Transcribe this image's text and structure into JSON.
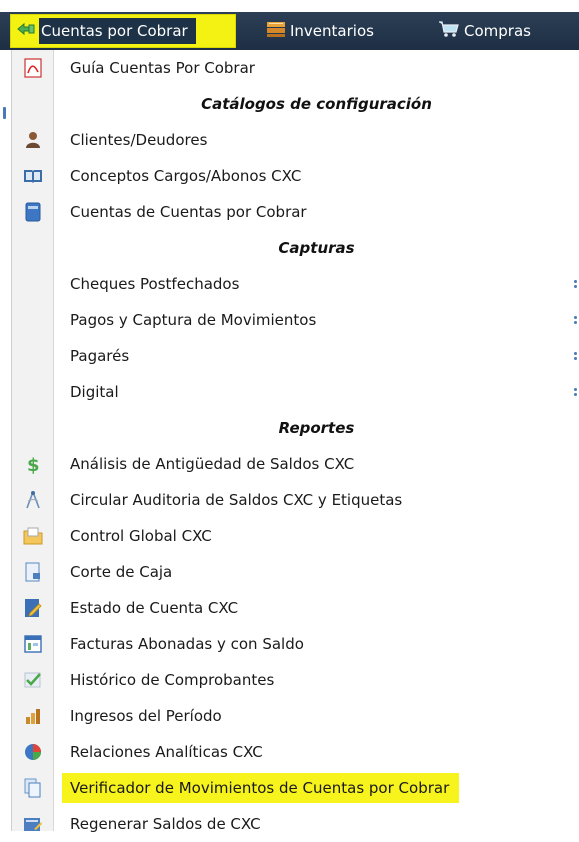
{
  "menubar": {
    "items": [
      {
        "label": "Cuentas por Cobrar",
        "icon": "cuentas-arrow-icon"
      },
      {
        "label": "Inventarios",
        "icon": "inventory-icon"
      },
      {
        "label": "Compras",
        "icon": "cart-icon"
      }
    ]
  },
  "dropdown": {
    "items": [
      {
        "label": "Guía Cuentas Por Cobrar",
        "icon": "pdf-icon"
      },
      {
        "label": "Catálogos de configuración",
        "header": true
      },
      {
        "label": "Clientes/Deudores",
        "icon": "person-icon"
      },
      {
        "label": "Conceptos Cargos/Abonos CXC",
        "icon": "book-icon"
      },
      {
        "label": "Cuentas de Cuentas por Cobrar",
        "icon": "ledger-icon"
      },
      {
        "label": "Capturas",
        "header": true
      },
      {
        "label": "Cheques Postfechados",
        "submenu": true
      },
      {
        "label": "Pagos y Captura de Movimientos",
        "submenu": true
      },
      {
        "label": "Pagarés",
        "submenu": true
      },
      {
        "label": "Digital",
        "submenu": true
      },
      {
        "label": "Reportes",
        "header": true
      },
      {
        "label": "Análisis de Antigüedad de Saldos CXC",
        "icon": "dollar-icon"
      },
      {
        "label": "Circular Auditoria de Saldos CXC y Etiquetas",
        "icon": "compass-icon"
      },
      {
        "label": "Control Global CXC",
        "icon": "folder-icon"
      },
      {
        "label": "Corte de Caja",
        "icon": "document-lock-icon"
      },
      {
        "label": "Estado de Cuenta CXC",
        "icon": "edit-document-icon"
      },
      {
        "label": "Facturas Abonadas y con Saldo",
        "icon": "table-icon"
      },
      {
        "label": "Histórico de Comprobantes",
        "icon": "checkmark-icon"
      },
      {
        "label": "Ingresos del Período",
        "icon": "bar-chart-icon"
      },
      {
        "label": "Relaciones Analíticas CXC",
        "icon": "pie-chart-icon"
      },
      {
        "label": "Verificador de Movimientos de Cuentas por Cobrar",
        "icon": "copy-documents-icon",
        "highlighted": true
      },
      {
        "label": "Regenerar Saldos de CXC",
        "icon": "refresh-document-icon"
      }
    ]
  },
  "colors": {
    "menubar": "#1e2f44",
    "highlight": "#f6f31d",
    "gutter": "#f2f2f2"
  }
}
